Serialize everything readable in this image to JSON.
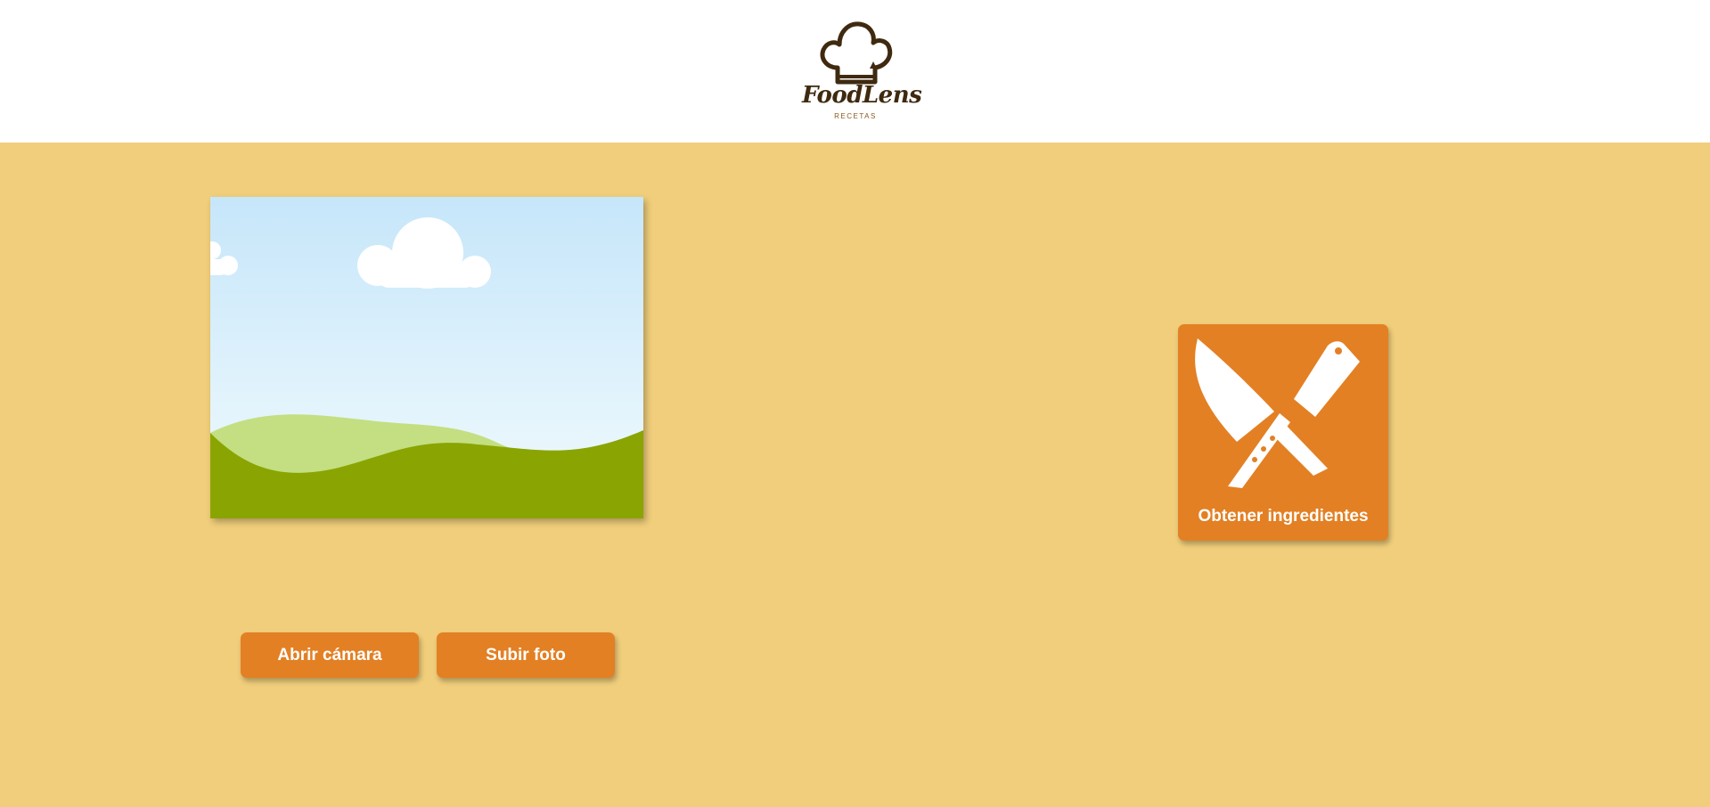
{
  "header": {
    "logo": {
      "icon": "chef-hat-icon",
      "name": "FoodLens",
      "subtitle": "RECETAS"
    }
  },
  "preview": {
    "placeholder_icon": "landscape-image-icon"
  },
  "actions": {
    "open_camera_label": "Abrir cámara",
    "upload_photo_label": "Subir foto"
  },
  "ingredients_button": {
    "icon": "crossed-knives-icon",
    "label": "Obtener ingredientes"
  },
  "colors": {
    "background": "#F0CE7B",
    "header": "#FFFFFF",
    "accent": "#E38024",
    "logo_brown": "#3F2A10"
  }
}
